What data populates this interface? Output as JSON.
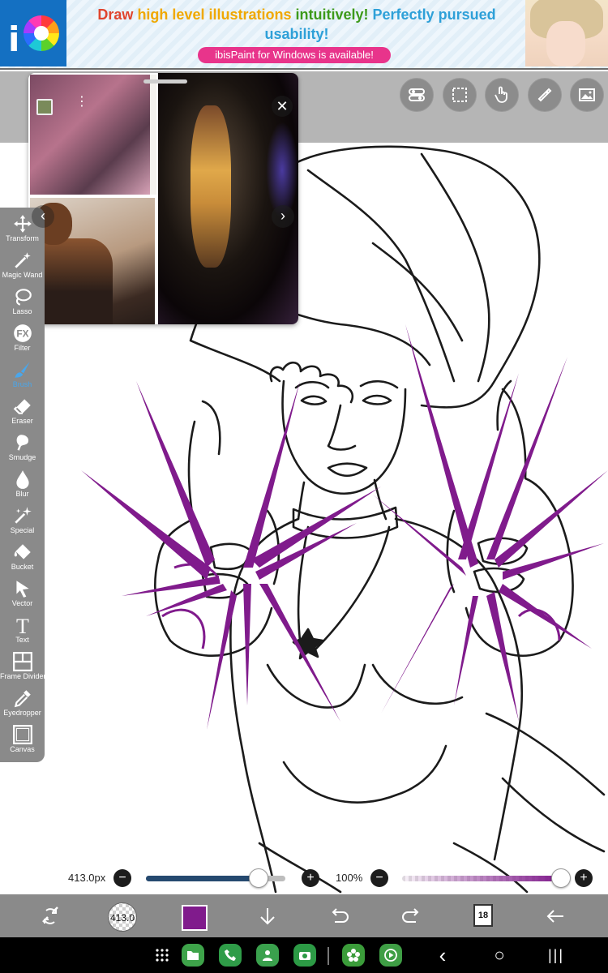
{
  "ad": {
    "headline_part1": "Draw",
    "headline_part2": "high level illustrations",
    "headline_part3": "intuitively!",
    "headline_part4": "Perfectly pursued usability!",
    "pill": "ibisPaint for Windows is available!"
  },
  "top_tools": [
    "toggle-icon",
    "selection-icon",
    "hand-touch-icon",
    "ruler-icon",
    "image-icon"
  ],
  "reference_viewer": {
    "close_glyph": "✕",
    "next_glyph": "›",
    "prev_glyph": "‹"
  },
  "left_toolbar": {
    "items": [
      {
        "label": "Transform",
        "icon": "move-icon"
      },
      {
        "label": "Magic Wand",
        "icon": "magic-wand-icon"
      },
      {
        "label": "Lasso",
        "icon": "lasso-icon"
      },
      {
        "label": "Filter",
        "icon": "fx-icon",
        "glyph": "FX"
      },
      {
        "label": "Brush",
        "icon": "brush-icon",
        "active": true
      },
      {
        "label": "Eraser",
        "icon": "eraser-icon"
      },
      {
        "label": "Smudge",
        "icon": "smudge-icon"
      },
      {
        "label": "Blur",
        "icon": "drop-icon"
      },
      {
        "label": "Special",
        "icon": "sparkle-icon"
      },
      {
        "label": "Bucket",
        "icon": "bucket-icon"
      },
      {
        "label": "Vector",
        "icon": "cursor-icon"
      },
      {
        "label": "Text",
        "icon": "text-icon",
        "glyph": "T"
      },
      {
        "label": "Frame Divider",
        "icon": "frame-divider-icon"
      },
      {
        "label": "Eyedropper",
        "icon": "eyedropper-icon"
      },
      {
        "label": "Canvas",
        "icon": "canvas-icon"
      }
    ],
    "active_color": "#4aa6ea"
  },
  "sliders": {
    "size_label": "413.0px",
    "size_fraction": 0.81,
    "opacity_label": "100%",
    "opacity_fraction": 1.0,
    "minus_glyph": "−",
    "plus_glyph": "+"
  },
  "bottom_toolbar": {
    "brush_size_text": "413.0",
    "current_color": "#801b8c",
    "layer_count": "18"
  },
  "navbar": {
    "apps": [
      "grid-icon",
      "folder-icon",
      "phone-icon",
      "contact-icon",
      "camera-icon",
      "ibis-flower-icon",
      "play-icon"
    ],
    "back_glyph": "‹",
    "home_glyph": "○",
    "recents_glyph": "|||"
  },
  "colors": {
    "accent_purple": "#801b8c",
    "toolbar_gray": "#8a8a8a",
    "slider_blue": "#25496f"
  }
}
